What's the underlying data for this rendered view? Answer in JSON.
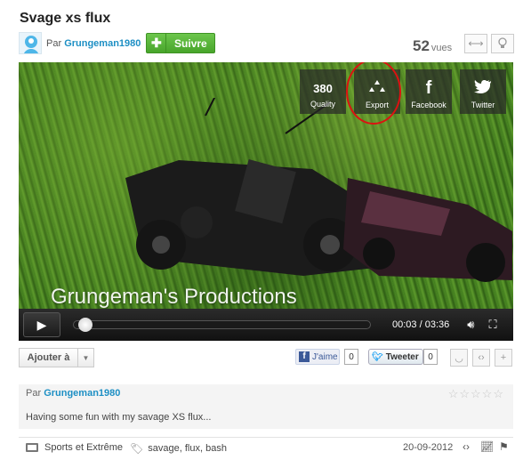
{
  "video": {
    "title": "Svage xs flux",
    "by_prefix": "Par",
    "author": "Grungeman1980",
    "follow_label": "Suivre",
    "views_count": "52",
    "views_label": "vues",
    "watermark": "Grungeman's Productions"
  },
  "share": {
    "quality_value": "380",
    "quality_label": "Quality",
    "export_label": "Export",
    "facebook_label": "Facebook",
    "twitter_label": "Twitter"
  },
  "player": {
    "time_current": "00:03",
    "time_total": "03:36",
    "progress_fraction": 0.015
  },
  "actions": {
    "add_label": "Ajouter à",
    "like_label": "J'aime",
    "like_count": "0",
    "tweet_label": "Tweeter",
    "tweet_count": "0"
  },
  "description": {
    "by_prefix": "Par",
    "author": "Grungeman1980",
    "text": "Having some fun with my savage XS flux...",
    "rating_stars": 0
  },
  "meta": {
    "category": "Sports et Extrême",
    "tags": [
      "savage",
      "flux",
      "bash"
    ],
    "date": "20-09-2012"
  },
  "colors": {
    "accent_blue": "#1d8fc4",
    "follow_green": "#48a52b",
    "highlight_red": "#dd1111"
  }
}
